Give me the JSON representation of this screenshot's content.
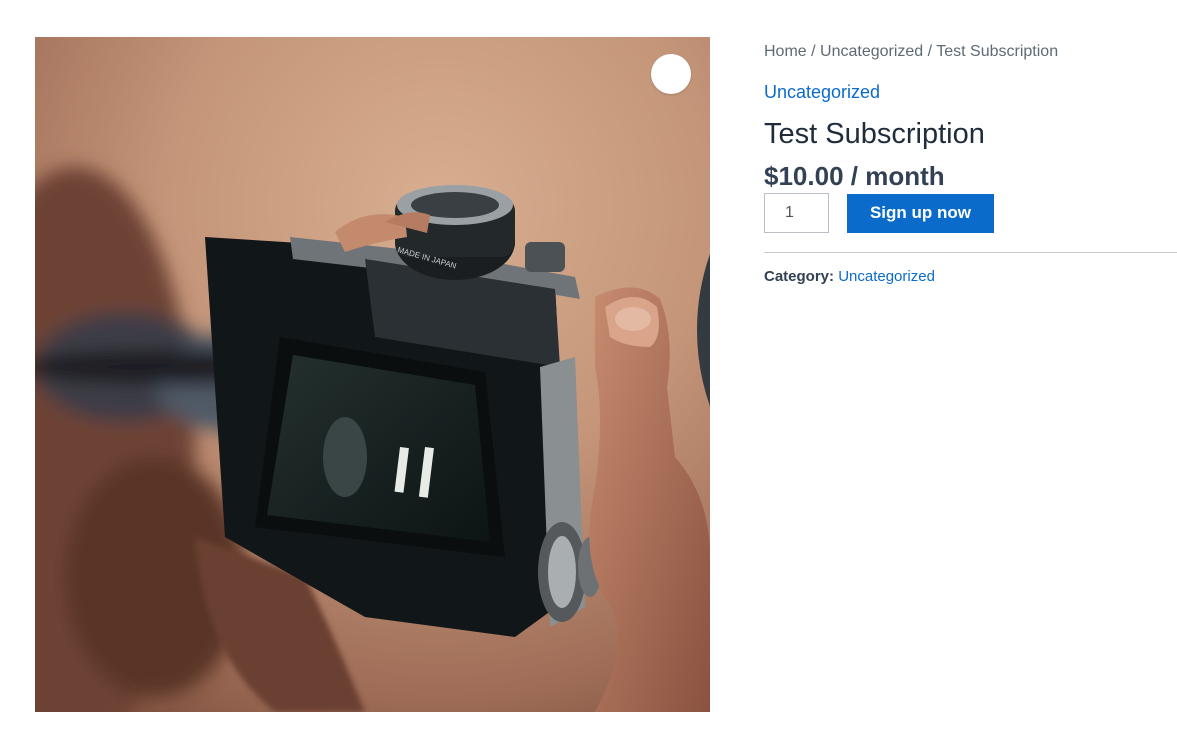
{
  "breadcrumb": {
    "home": "Home",
    "sep1": " / ",
    "category": "Uncategorized",
    "sep2": " / ",
    "current": "Test Subscription"
  },
  "product": {
    "category_link": "Uncategorized",
    "title": "Test Subscription",
    "price": "$10.00 / month",
    "quantity": "1",
    "signup_label": "Sign up now",
    "meta_label": "Category:",
    "meta_value": "Uncategorized"
  },
  "gallery": {
    "zoom_icon": "magnifier-icon",
    "image_subject": "camera-photo",
    "lens_text": "MADE IN JAPAN"
  },
  "colors": {
    "accent": "#0b6bcb",
    "heading": "#1f2d3a",
    "text": "#334155",
    "muted": "#5e6a74",
    "divider": "#c3c8cd"
  }
}
